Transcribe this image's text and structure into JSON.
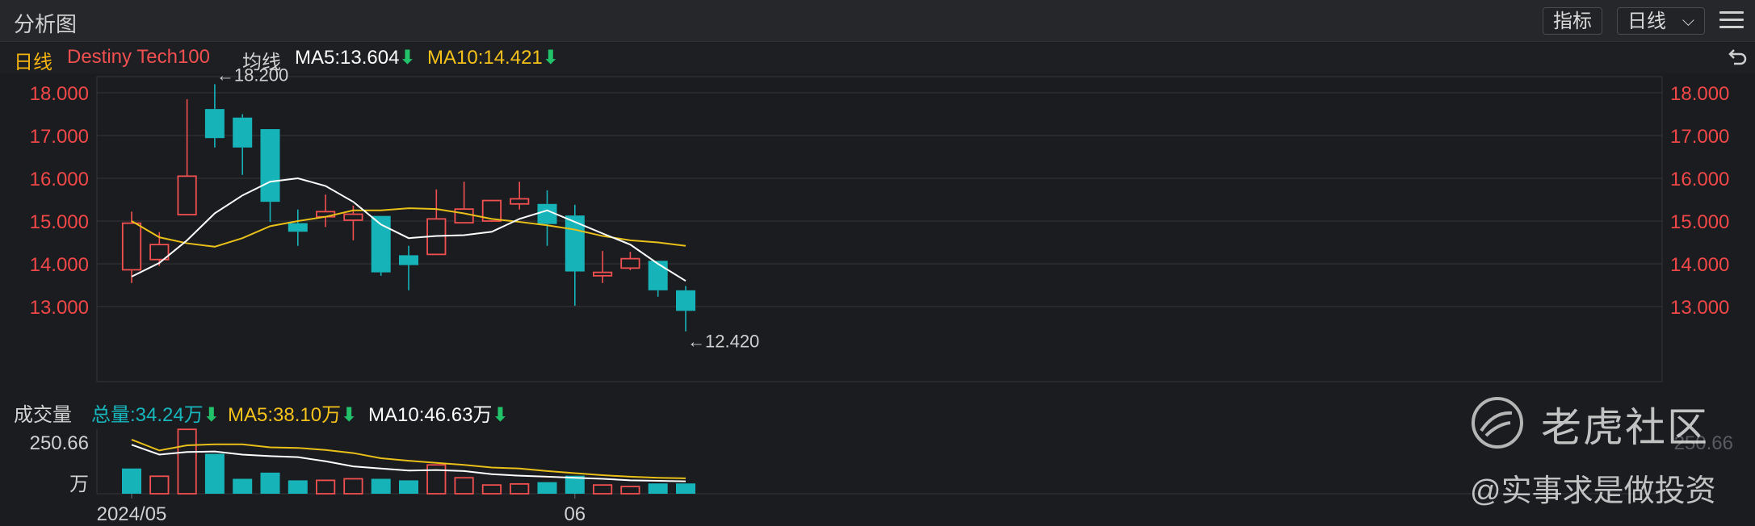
{
  "header": {
    "title": "分析图",
    "indicator_button": "指标",
    "period_button": "日线",
    "period_chevron": "⌵"
  },
  "legend": {
    "period": "日线",
    "symbol": "Destiny Tech100",
    "ma_label": "均线",
    "ma5": "MA5:13.604",
    "ma10": "MA10:14.421",
    "arrow": "⬇"
  },
  "volume_legend": {
    "label": "成交量",
    "total": "总量:34.24万",
    "ma5": "MA5:38.10万",
    "ma10": "MA10:46.63万",
    "arrow": "⬇"
  },
  "watermark": {
    "brand": "老虎社区",
    "author": "@实事求是做投资"
  },
  "colors": {
    "up": "#f0504f",
    "down": "#16b3b9",
    "ma5": "#ffffff",
    "ma10": "#e8c019",
    "grid": "#34353a",
    "axis_text": "#f04848",
    "ma5_legend": "#ffffff",
    "ma10_legend": "#f5c21b",
    "symbol": "#f05050",
    "period_legend": "#f5b40f",
    "volume_total": "#17b6bd",
    "arrow_down": "#21c26a"
  },
  "icons": {
    "reset": "undo-icon",
    "menu": "hamburger-menu-icon",
    "chevron": "chevron-down-icon",
    "logo": "tiger-logo-icon"
  },
  "chart_data": [
    {
      "type": "candlestick",
      "title": "",
      "y_ticks": [
        "18.000",
        "17.000",
        "16.000",
        "15.000",
        "14.000",
        "13.000"
      ],
      "ylim": [
        12.0,
        18.4
      ],
      "x_tick_labels": [
        {
          "label": "2024/05",
          "index": 0
        },
        {
          "label": "06",
          "index": 16
        }
      ],
      "annotations": {
        "high": "←18.200",
        "low": "←12.420"
      },
      "candles": [
        {
          "open": 13.86,
          "close": 14.95,
          "high": 15.22,
          "low": 13.55
        },
        {
          "open": 14.1,
          "close": 14.45,
          "high": 14.74,
          "low": 13.95
        },
        {
          "open": 15.15,
          "close": 16.05,
          "high": 17.85,
          "low": 15.15
        },
        {
          "open": 17.62,
          "close": 16.94,
          "high": 18.2,
          "low": 16.72
        },
        {
          "open": 17.42,
          "close": 16.72,
          "high": 17.5,
          "low": 16.08
        },
        {
          "open": 17.15,
          "close": 15.45,
          "high": 17.15,
          "low": 14.98
        },
        {
          "open": 14.95,
          "close": 14.75,
          "high": 15.27,
          "low": 14.42
        },
        {
          "open": 15.1,
          "close": 15.22,
          "high": 15.62,
          "low": 14.86
        },
        {
          "open": 15.02,
          "close": 15.16,
          "high": 15.36,
          "low": 14.55
        },
        {
          "open": 15.12,
          "close": 13.8,
          "high": 15.12,
          "low": 13.72
        },
        {
          "open": 14.2,
          "close": 13.97,
          "high": 14.42,
          "low": 13.38
        },
        {
          "open": 14.22,
          "close": 15.05,
          "high": 15.74,
          "low": 14.22
        },
        {
          "open": 14.96,
          "close": 15.28,
          "high": 15.92,
          "low": 14.96
        },
        {
          "open": 15.0,
          "close": 15.48,
          "high": 15.48,
          "low": 14.98
        },
        {
          "open": 15.4,
          "close": 15.52,
          "high": 15.92,
          "low": 15.27
        },
        {
          "open": 15.4,
          "close": 14.93,
          "high": 15.72,
          "low": 14.42
        },
        {
          "open": 15.13,
          "close": 13.82,
          "high": 15.38,
          "low": 13.02
        },
        {
          "open": 13.72,
          "close": 13.8,
          "high": 14.3,
          "low": 13.55
        },
        {
          "open": 13.9,
          "close": 14.12,
          "high": 14.28,
          "low": 13.85
        },
        {
          "open": 14.07,
          "close": 13.38,
          "high": 14.07,
          "low": 13.23
        },
        {
          "open": 13.38,
          "close": 12.9,
          "high": 13.48,
          "low": 12.42
        }
      ],
      "ma5": [
        13.7,
        14.02,
        14.55,
        15.18,
        15.6,
        15.92,
        16.0,
        15.82,
        15.45,
        14.92,
        14.6,
        14.65,
        14.67,
        14.75,
        15.05,
        15.25,
        14.98,
        14.71,
        14.45,
        14.0,
        13.6
      ],
      "ma10": [
        15.0,
        14.62,
        14.48,
        14.4,
        14.6,
        14.88,
        15.0,
        15.1,
        15.25,
        15.25,
        15.3,
        15.28,
        15.18,
        15.05,
        14.98,
        14.9,
        14.8,
        14.65,
        14.55,
        14.5,
        14.42
      ]
    },
    {
      "type": "bar",
      "title": "",
      "y_tick_label": "250.66",
      "y_unit": "万",
      "ylim": [
        0,
        250.66
      ],
      "values": [
        98,
        68,
        250,
        155,
        58,
        82,
        52,
        52,
        58,
        58,
        52,
        112,
        62,
        34,
        38,
        45,
        70,
        34,
        28,
        40,
        40
      ],
      "directions": [
        "down",
        "up",
        "up",
        "down",
        "down",
        "down",
        "down",
        "up",
        "up",
        "down",
        "down",
        "up",
        "up",
        "up",
        "up",
        "down",
        "down",
        "up",
        "up",
        "down",
        "down"
      ],
      "ma5": [
        210,
        168,
        188,
        192,
        192,
        180,
        178,
        170,
        158,
        138,
        128,
        120,
        112,
        102,
        98,
        88,
        80,
        72,
        66,
        62,
        60
      ],
      "ma10": [
        190,
        152,
        162,
        164,
        152,
        146,
        142,
        126,
        106,
        98,
        90,
        92,
        88,
        76,
        70,
        66,
        62,
        58,
        52,
        50,
        48
      ]
    }
  ]
}
